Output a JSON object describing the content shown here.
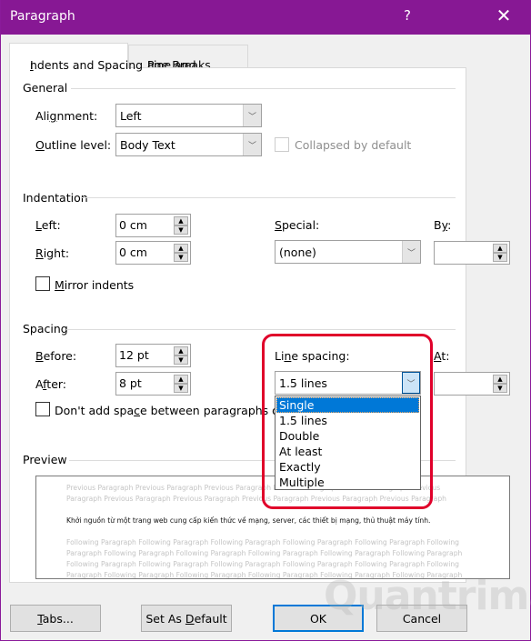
{
  "window": {
    "title": "Paragraph",
    "help_label": "?",
    "close_label": "✕"
  },
  "tabs": [
    {
      "label_pre": "",
      "label_u": "I",
      "label_post": "ndents and Spacing",
      "active": true
    },
    {
      "label_pre": "Line and ",
      "label_u": "P",
      "label_post": "age Breaks",
      "active": false
    }
  ],
  "general": {
    "heading": "General",
    "alignment": {
      "label_pre": "Ali",
      "label_u": "g",
      "label_post": "nment:",
      "value": "Left"
    },
    "outline_level": {
      "label_pre": "",
      "label_u": "O",
      "label_post": "utline level:",
      "value": "Body Text"
    },
    "collapsed": {
      "label": "Collapsed by default",
      "checked": false,
      "disabled": true
    }
  },
  "indentation": {
    "heading": "Indentation",
    "left": {
      "label_u": "L",
      "label_post": "eft:",
      "value": "0 cm"
    },
    "right": {
      "label_u": "R",
      "label_post": "ight:",
      "value": "0 cm"
    },
    "special": {
      "label_u": "S",
      "label_post": "pecial:",
      "value": "(none)"
    },
    "by": {
      "label_pre": "B",
      "label_u": "y",
      "label_post": ":",
      "value": ""
    },
    "mirror": {
      "label_u": "M",
      "label_post": "irror indents",
      "checked": false
    }
  },
  "spacing": {
    "heading": "Spacing",
    "before": {
      "label_u": "B",
      "label_post": "efore:",
      "value": "12 pt"
    },
    "after": {
      "label_pre": "A",
      "label_u": "f",
      "label_post": "ter:",
      "value": "8 pt"
    },
    "line_spacing": {
      "label_pre": "Li",
      "label_u": "n",
      "label_post": "e spacing:",
      "value": "1.5 lines"
    },
    "at": {
      "label_u": "A",
      "label_post": "t:",
      "value": ""
    },
    "dont_add": {
      "label_pre": "Don't add spa",
      "label_u": "c",
      "label_post": "e between paragraphs of t",
      "checked": false
    },
    "line_spacing_options": [
      "Single",
      "1.5 lines",
      "Double",
      "At least",
      "Exactly",
      "Multiple"
    ],
    "highlighted_option": "Single"
  },
  "preview": {
    "heading": "Preview",
    "previous_lines": [
      "Previous Paragraph Previous Paragraph Previous Paragraph Previous Paragraph Previous Paragraph Previous",
      "Paragraph Previous Paragraph Previous Paragraph Previous Paragraph Previous Paragraph Previous Paragraph"
    ],
    "sample_text": "Khởi nguồn từ một trang web cung cấp kiến thức về mạng, server, các thiết bị mạng, thủ thuật máy tính.",
    "following_lines": [
      "Following Paragraph Following Paragraph Following Paragraph Following Paragraph Following Paragraph Following",
      "Paragraph Following Paragraph Following Paragraph Following Paragraph Following Paragraph Following Paragraph",
      "Following Paragraph Following Paragraph Following Paragraph Following Paragraph Following Paragraph Following",
      "Paragraph Following Paragraph Following Paragraph Following Paragraph Following Paragraph Following Paragraph"
    ]
  },
  "buttons": {
    "tabs": {
      "label_u": "T",
      "label_post": "abs..."
    },
    "set_default": {
      "label_pre": "Set As ",
      "label_u": "D",
      "label_post": "efault"
    },
    "ok": "OK",
    "cancel": "Cancel"
  },
  "watermark": "Quantrimang",
  "colors": {
    "titlebar": "#871894",
    "accent": "#0078d7",
    "highlight_box": "#e0002a"
  }
}
